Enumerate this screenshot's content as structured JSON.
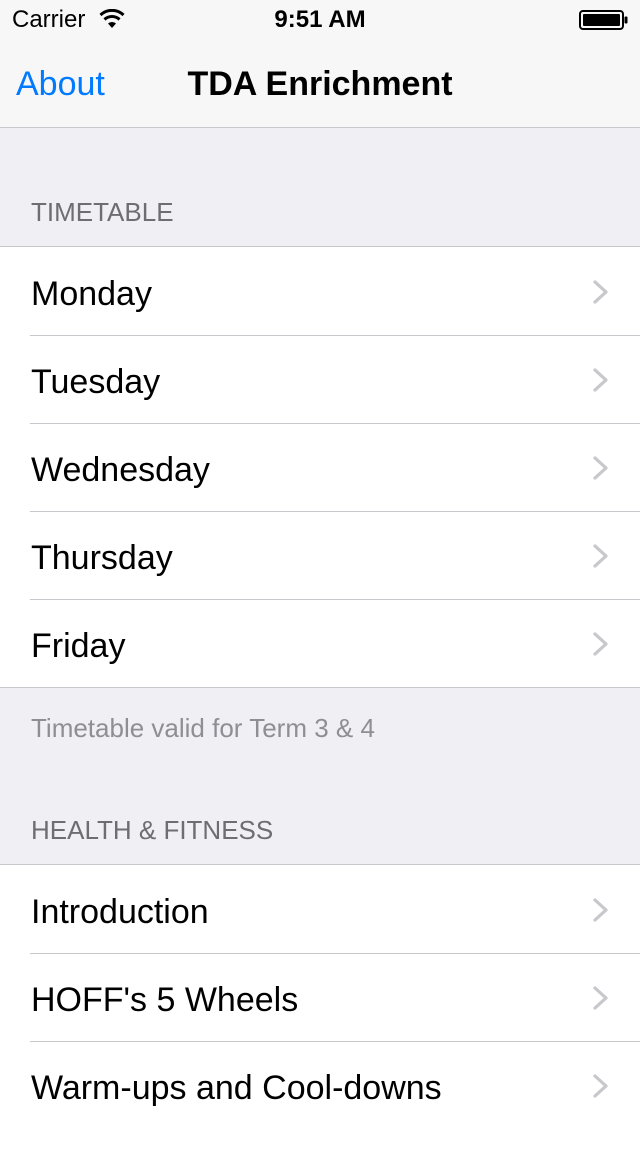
{
  "status_bar": {
    "carrier": "Carrier",
    "time": "9:51 AM"
  },
  "nav": {
    "back_label": "About",
    "title": "TDA Enrichment"
  },
  "sections": {
    "timetable": {
      "header": "TIMETABLE",
      "items": [
        "Monday",
        "Tuesday",
        "Wednesday",
        "Thursday",
        "Friday"
      ],
      "footer": "Timetable valid for Term 3 & 4"
    },
    "health": {
      "header": "HEALTH & FITNESS",
      "items": [
        "Introduction",
        "HOFF's 5 Wheels",
        "Warm-ups and Cool-downs"
      ]
    }
  },
  "colors": {
    "tint": "#007aff",
    "background": "#efeff4",
    "separator": "#c8c7cc",
    "chevron": "#c7c7cc"
  },
  "icons": {
    "wifi": "wifi-icon",
    "battery": "battery-icon",
    "disclosure": "chevron-right-icon"
  }
}
